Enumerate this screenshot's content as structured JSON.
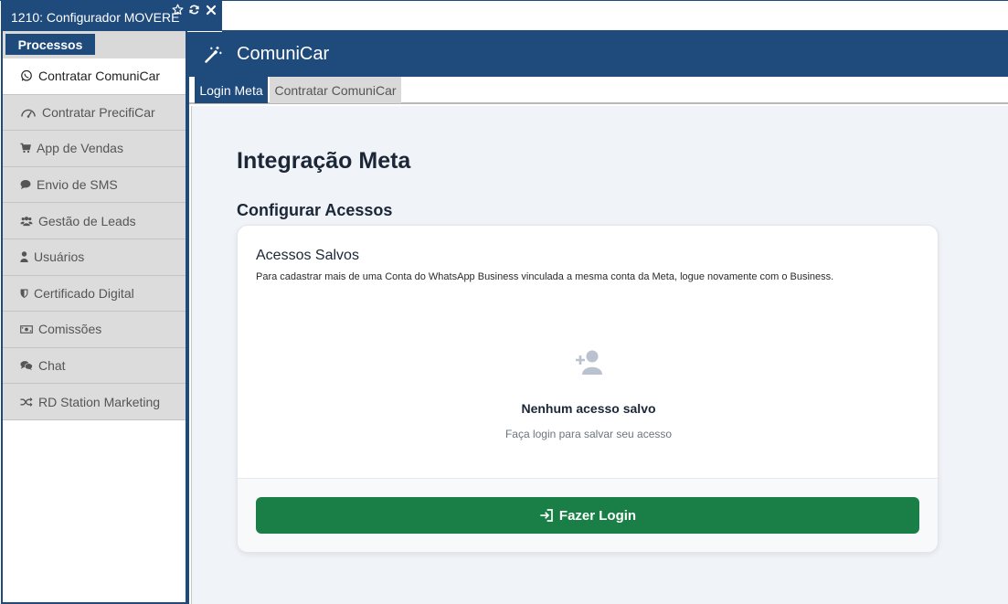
{
  "window": {
    "title": "1210: Configurador MOVERE",
    "icons": [
      "star-icon",
      "refresh-icon",
      "close-icon"
    ]
  },
  "sidebar": {
    "section_label": "Processos",
    "items": [
      {
        "label": "Contratar ComuniCar",
        "icon": "whatsapp-icon",
        "active": true
      },
      {
        "label": "Contratar PrecifiCar",
        "icon": "dashboard-icon",
        "active": false
      },
      {
        "label": "App de Vendas",
        "icon": "cart-icon",
        "active": false
      },
      {
        "label": "Envio de SMS",
        "icon": "comment-icon",
        "active": false
      },
      {
        "label": "Gestão de Leads",
        "icon": "users-icon",
        "active": false
      },
      {
        "label": "Usuários",
        "icon": "user-icon",
        "active": false
      },
      {
        "label": "Certificado Digital",
        "icon": "shield-icon",
        "active": false
      },
      {
        "label": "Comissões",
        "icon": "money-icon",
        "active": false
      },
      {
        "label": "Chat",
        "icon": "chat-icon",
        "active": false
      },
      {
        "label": "RD Station Marketing",
        "icon": "shuffle-icon",
        "active": false
      }
    ]
  },
  "header": {
    "title": "ComuniCar",
    "icon": "magic-wand-icon"
  },
  "tabs": [
    {
      "label": "Login Meta",
      "active": true
    },
    {
      "label": "Contratar ComuniCar",
      "active": false
    }
  ],
  "content": {
    "title": "Integração Meta",
    "subtitle": "Configurar Acessos",
    "card": {
      "title": "Acessos Salvos",
      "description": "Para cadastrar mais de uma Conta do WhatsApp Business vinculada a mesma conta da Meta, logue novamente com o Business.",
      "empty_title": "Nenhum acesso salvo",
      "empty_subtitle": "Faça login para salvar seu acesso",
      "button_label": "Fazer Login"
    }
  },
  "colors": {
    "primary": "#1f4a7c",
    "button": "#1a7f47",
    "background": "#f0f3f7"
  }
}
